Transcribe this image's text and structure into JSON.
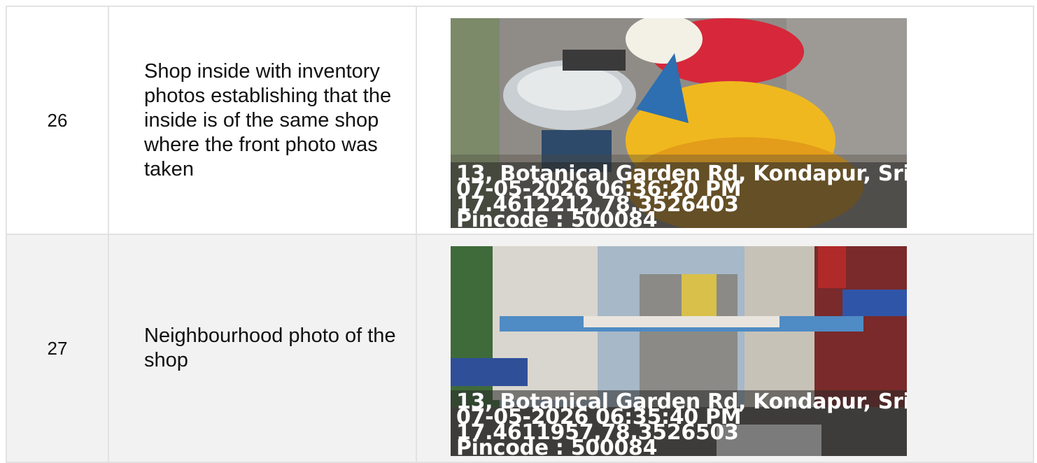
{
  "rows": [
    {
      "number": "26",
      "description": "Shop inside with inventory photos establishing that the inside is of the same shop where the front photo was taken",
      "photo": {
        "subject": "flower-stall-inventory",
        "address": "13, Botanical Garden Rd, Kondapur, Sri ...",
        "datetime": "07-05-2026 06:36:20 PM",
        "coordinates": "17.4612212,78.3526403",
        "pincode": "Pincode : 500084"
      }
    },
    {
      "number": "27",
      "description": "Neighbourhood photo of the shop",
      "photo": {
        "subject": "street-neighbourhood",
        "address": "13, Botanical Garden Rd, Kondapur, Sri ...",
        "datetime": "07-05-2026 06:35:40 PM",
        "coordinates": "17.4611957,78.3526503",
        "pincode": "Pincode : 500084"
      }
    }
  ]
}
